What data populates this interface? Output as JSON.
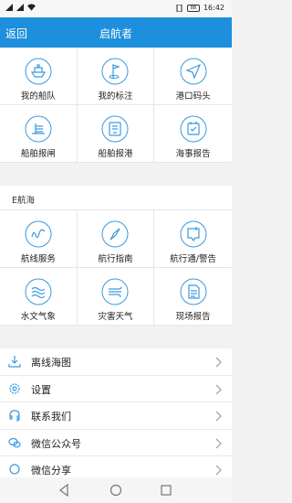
{
  "status_bar": {
    "battery": "88",
    "time": "16:42"
  },
  "header": {
    "back_label": "返回",
    "title": "启航者"
  },
  "top_grid": [
    {
      "label": "我的船队",
      "icon": "ship-icon"
    },
    {
      "label": "我的标注",
      "icon": "flag-icon"
    },
    {
      "label": "港口码头",
      "icon": "navigation-arrow-icon"
    },
    {
      "label": "船舶报闸",
      "icon": "lock-gate-icon"
    },
    {
      "label": "船舶报港",
      "icon": "port-report-icon"
    },
    {
      "label": "海事报告",
      "icon": "calendar-check-icon"
    }
  ],
  "section": {
    "title": "E航海"
  },
  "ehanghai_grid": [
    {
      "label": "航线服务",
      "icon": "route-icon"
    },
    {
      "label": "航行指南",
      "icon": "compass-icon"
    },
    {
      "label": "航行通/警告",
      "icon": "notice-icon"
    },
    {
      "label": "水文气象",
      "icon": "waves-icon"
    },
    {
      "label": "灾害天气",
      "icon": "wind-icon"
    },
    {
      "label": "现场报告",
      "icon": "document-icon"
    }
  ],
  "list": [
    {
      "label": "离线海图",
      "icon": "download-icon"
    },
    {
      "label": "设置",
      "icon": "gear-icon"
    },
    {
      "label": "联系我们",
      "icon": "headset-icon"
    },
    {
      "label": "微信公众号",
      "icon": "wechat-icon"
    },
    {
      "label": "微信分享",
      "icon": "share-icon"
    }
  ],
  "colors": {
    "accent": "#1d8fdc",
    "icon_blue": "#3a9ae0",
    "background": "#f2f2f2"
  }
}
